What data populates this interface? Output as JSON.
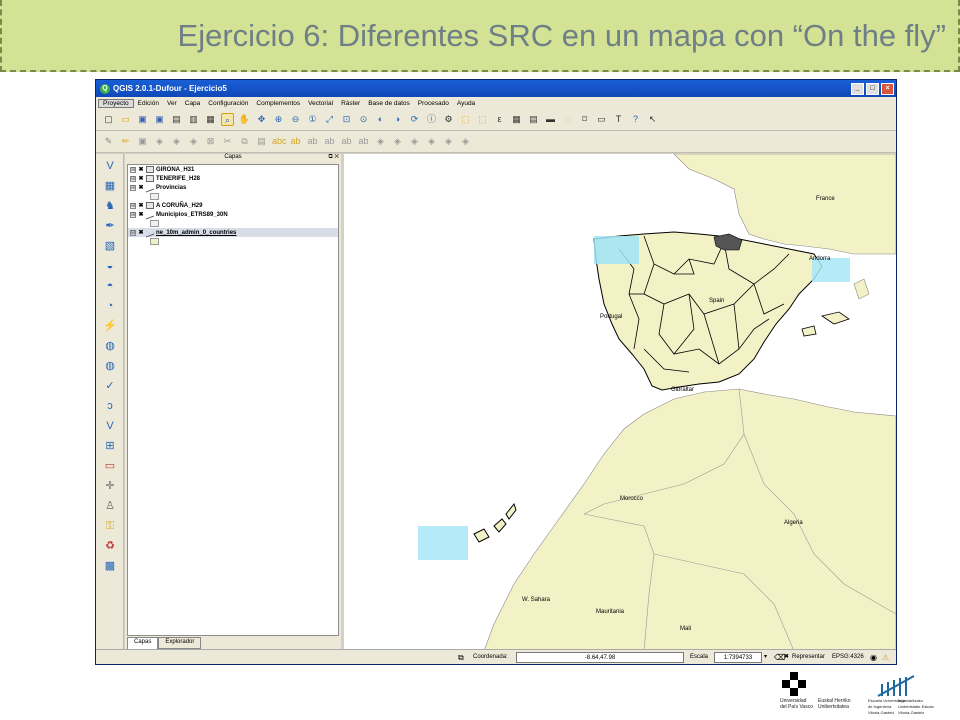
{
  "slide": {
    "title": "Ejercicio 6: Diferentes SRC en un mapa con “On the fly”"
  },
  "window": {
    "title": "QGIS 2.0.1-Dufour - Ejercicio5",
    "controls": [
      "_",
      "□",
      "×"
    ]
  },
  "menu": [
    "Proyecto",
    "Edición",
    "Ver",
    "Capa",
    "Configuración",
    "Complementos",
    "Vectorial",
    "Ráster",
    "Base de datos",
    "Procesado",
    "Ayuda"
  ],
  "layers_panel": {
    "title": "Capas",
    "layers": [
      {
        "name": "GIRONA_H31",
        "expander": "⊞",
        "visible": "✖"
      },
      {
        "name": "TENERIFE_H28",
        "expander": "⊞",
        "visible": "✖"
      },
      {
        "name": "Provincias",
        "expander": "⊞",
        "visible": "✖"
      },
      {
        "name": "A CORUÑA_H29",
        "expander": "⊞",
        "visible": "✖"
      },
      {
        "name": "Municipios_ETRS89_30N",
        "expander": "⊞",
        "visible": "✖"
      },
      {
        "name": "ne_10m_admin_0_countries",
        "expander": "⊟",
        "visible": "✖"
      }
    ],
    "tabs": [
      "Capas",
      "Explorador"
    ]
  },
  "map_labels": [
    "France",
    "Andorra",
    "Spain",
    "Portugal",
    "Gibraltar",
    "Morocco",
    "Algeria",
    "W. Sahara",
    "Mauritania",
    "Mali"
  ],
  "status": {
    "coord_label": "Coordenada:",
    "coord_value": "-8.64,47.98",
    "scale_label": "Escala",
    "scale_value": "1:7394733",
    "render_label": "Representar",
    "crs": "EPSG:4326"
  },
  "logos": {
    "upv_lines": [
      "Universidad",
      "del País Vasco"
    ],
    "ehu_lines": [
      "Euskal Herriko",
      "Unibertsitatea"
    ],
    "school_lines": [
      "Escuela Universitaria",
      "de Ingeniería",
      "Vitoria-Gasteiz"
    ],
    "school2_lines": [
      "Ingeniaritzako",
      "Unibertsitate Eskola",
      "Vitoria-Gasteiz"
    ]
  },
  "colors": {
    "header_bg": "#d3e294",
    "land": "#f3f1c6",
    "spain_fill": "#f3f1c6",
    "titlebar": "#1a5fd6"
  }
}
